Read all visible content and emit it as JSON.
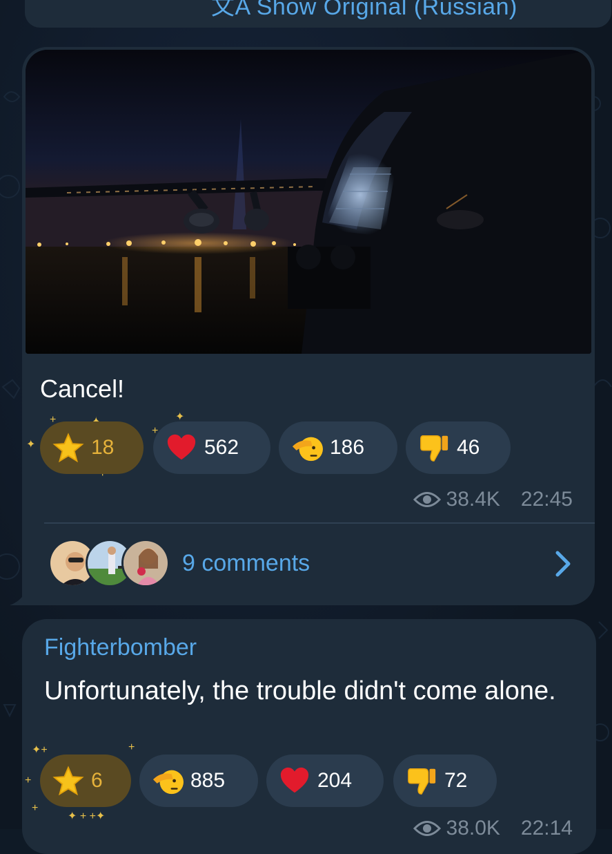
{
  "top_bubble": {
    "show_original_label": "文A Show Original (Russian)"
  },
  "post": {
    "caption": "Cancel!",
    "reactions": [
      {
        "icon": "star-icon",
        "count": "18"
      },
      {
        "icon": "heart-icon",
        "count": "562"
      },
      {
        "icon": "saluting-face-icon",
        "count": "186"
      },
      {
        "icon": "thumbs-down-icon",
        "count": "46"
      }
    ],
    "views": "38.4K",
    "time": "22:45",
    "comments_label": "9 comments"
  },
  "post2": {
    "author": "Fighterbomber",
    "text": "Unfortunately, the trouble didn't come alone.",
    "reactions": [
      {
        "icon": "star-icon",
        "count": "6"
      },
      {
        "icon": "saluting-face-icon",
        "count": "885"
      },
      {
        "icon": "heart-icon",
        "count": "204"
      },
      {
        "icon": "thumbs-down-icon",
        "count": "72"
      }
    ],
    "views": "38.0K",
    "time": "22:14"
  },
  "colors": {
    "bubble": "#1e2c3a",
    "link": "#58a8e8",
    "chip": "#2b3c4e",
    "star_chip": "#5a4a22",
    "meta": "#7d8b99"
  }
}
